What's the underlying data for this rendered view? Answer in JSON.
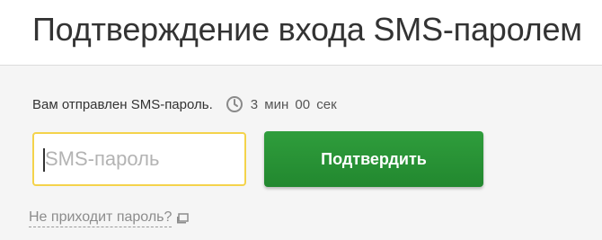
{
  "header": {
    "title": "Подтверждение входа SMS-паролем"
  },
  "sms": {
    "sent_text": "Вам отправлен SMS-пароль.",
    "timer_text": "3 мин 00 сек",
    "input_placeholder": "SMS-пароль",
    "input_value": "",
    "confirm_label": "Подтвердить",
    "no_password_link": "Не приходит пароль?"
  },
  "icons": {
    "timer": "clock-icon",
    "link": "popup-window-icon"
  },
  "colors": {
    "accent_green": "#22882f",
    "input_focus_border": "#f4d34b",
    "panel_background": "#f5f5f5"
  }
}
